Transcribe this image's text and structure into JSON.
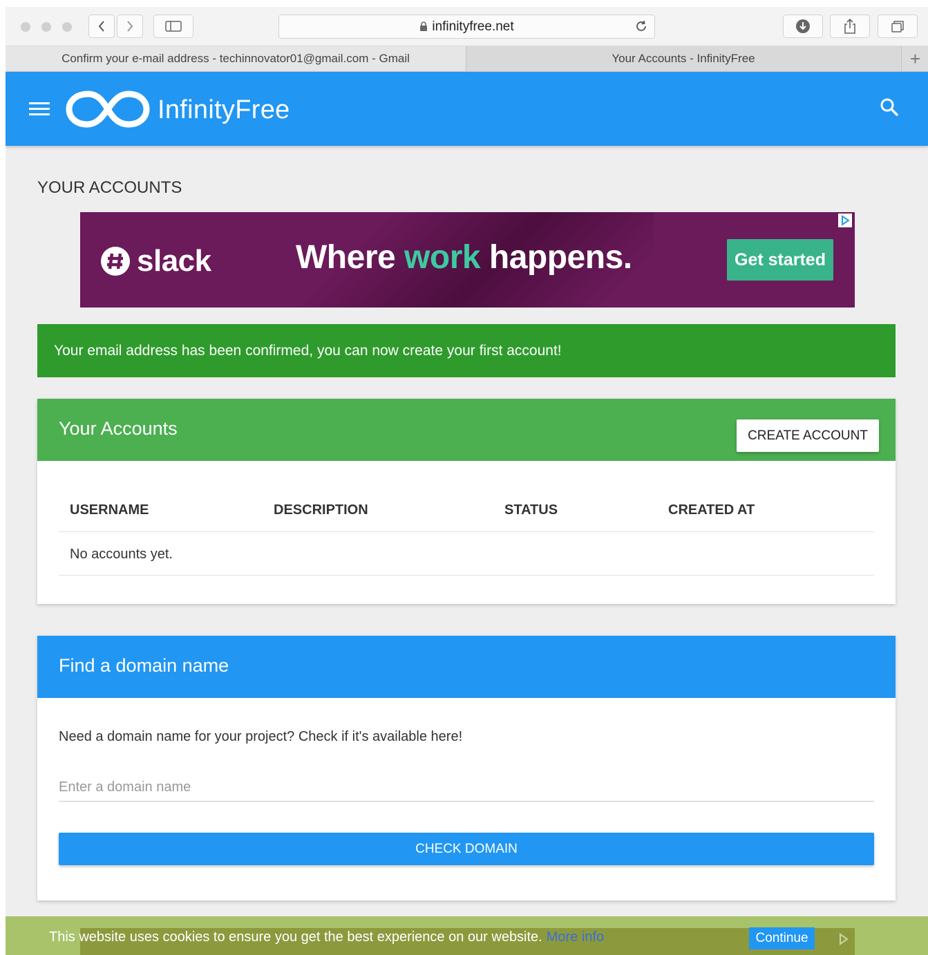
{
  "browser": {
    "url": "infinityfree.net",
    "tabs": [
      {
        "title": "Confirm your e-mail address - techinnovator01@gmail.com - Gmail"
      },
      {
        "title": "Your Accounts - InfinityFree"
      }
    ],
    "new_tab_label": "+"
  },
  "header": {
    "brand": "InfinityFree",
    "color": "#2196f3"
  },
  "page": {
    "title": "YOUR ACCOUNTS"
  },
  "ad": {
    "brand": "slack",
    "headline_pre": "Where ",
    "headline_accent": "work",
    "headline_post": " happens.",
    "cta": "Get started",
    "background": "#6b1a5a"
  },
  "alert": {
    "message": "Your email address has been confirmed, you can now create your first account!",
    "color": "#2e9b2c"
  },
  "accounts_card": {
    "title": "Your Accounts",
    "create_button": "CREATE ACCOUNT",
    "columns": [
      "USERNAME",
      "DESCRIPTION",
      "STATUS",
      "CREATED AT"
    ],
    "empty_message": "No accounts yet.",
    "color": "#4caf50"
  },
  "domain_card": {
    "title": "Find a domain name",
    "description": "Need a domain name for your project? Check if it's available here!",
    "input_placeholder": "Enter a domain name",
    "input_value": "",
    "button": "CHECK DOMAIN"
  },
  "cookie_bar": {
    "message": "This website uses cookies to ensure you get the best experience on our website.",
    "more_link": "More info",
    "continue_button": "Continue"
  },
  "icons": {
    "lock": "lock-icon",
    "reload": "reload-icon",
    "download": "download-icon",
    "share": "share-icon",
    "tabs": "tabs-overview-icon",
    "search": "search-icon",
    "menu": "hamburger-menu-icon"
  }
}
